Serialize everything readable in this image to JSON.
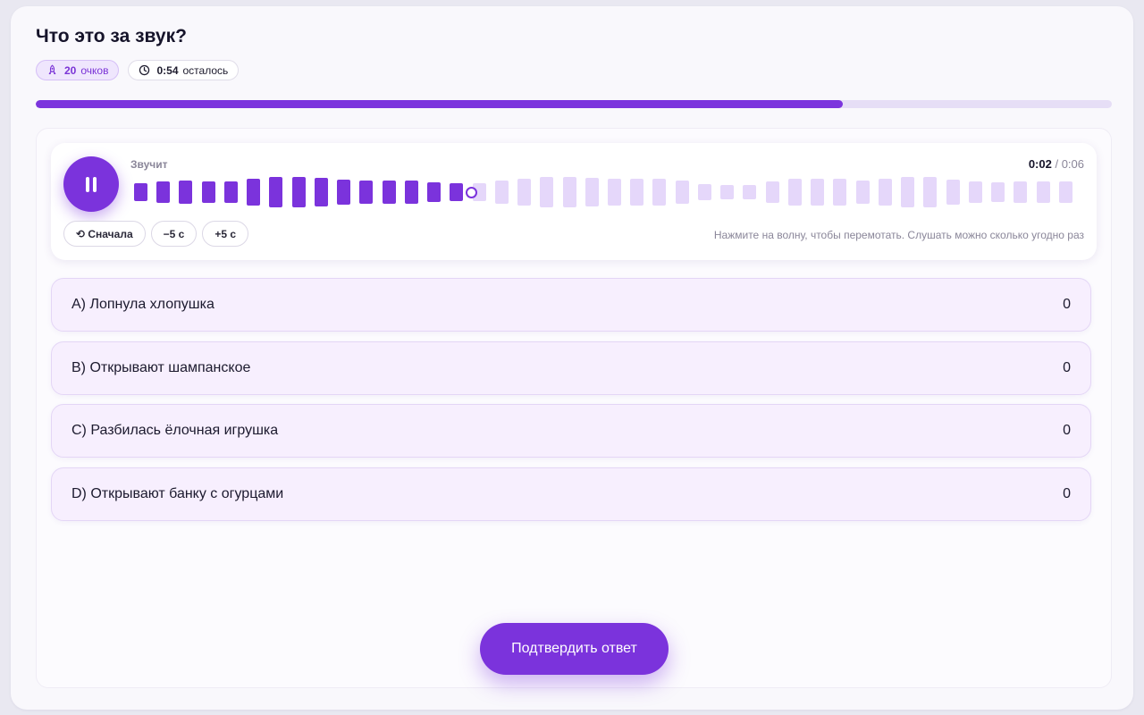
{
  "quiz": {
    "title": "Что это за звук?",
    "points": {
      "value": "20",
      "label": "очков"
    },
    "timer": {
      "value": "0:54",
      "label": "осталось"
    },
    "progress": 0.75
  },
  "player": {
    "status": "Звучит",
    "current_time": "0:02",
    "separator": " / ",
    "total_time": "0:06",
    "played_fraction": 0.333,
    "controls": {
      "restart": "⟲ Сначала",
      "back": "−5 с",
      "forward": "+5 с"
    },
    "hint": "Нажмите на волну, чтобы перемотать. Слушать можно сколько угодно раз"
  },
  "options": [
    {
      "text": "A) Лопнула хлопушка",
      "count": "0"
    },
    {
      "text": "B) Открывают шампанское",
      "count": "0"
    },
    {
      "text": "C) Разбилась ёлочная игрушка",
      "count": "0"
    },
    {
      "text": "D) Открывают банку с огурцами",
      "count": "0"
    }
  ],
  "submit_label": "Подтвердить ответ",
  "colors": {
    "accent": "#7b33dc",
    "accent_light": "#e5d7fa",
    "option_bg": "#f7effe"
  }
}
